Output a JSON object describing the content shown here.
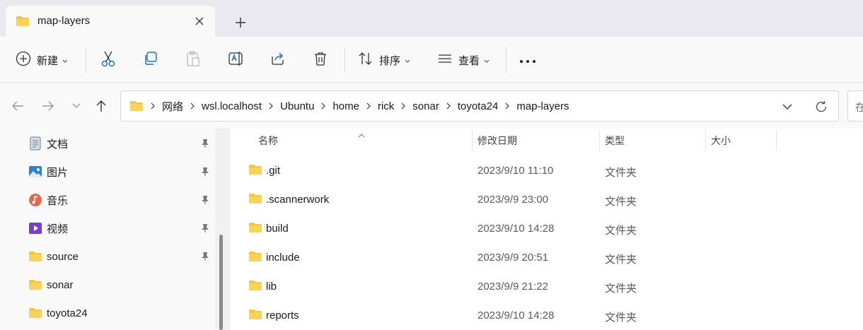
{
  "window": {
    "tab_title": "map-layers"
  },
  "toolbar": {
    "new_label": "新建",
    "sort_label": "排序",
    "view_label": "查看"
  },
  "address": {
    "crumbs": [
      "网络",
      "wsl.localhost",
      "Ubuntu",
      "home",
      "rick",
      "sonar",
      "toyota24",
      "map-layers"
    ],
    "search_placeholder": "在"
  },
  "sidebar": {
    "items": [
      {
        "label": "文档",
        "icon": "documents-icon",
        "pinned": true
      },
      {
        "label": "图片",
        "icon": "pictures-icon",
        "pinned": true
      },
      {
        "label": "音乐",
        "icon": "music-icon",
        "pinned": true
      },
      {
        "label": "视频",
        "icon": "videos-icon",
        "pinned": true
      },
      {
        "label": "source",
        "icon": "folder-icon",
        "pinned": true
      },
      {
        "label": "sonar",
        "icon": "folder-icon",
        "pinned": false
      },
      {
        "label": "toyota24",
        "icon": "folder-icon",
        "pinned": false
      }
    ]
  },
  "file_list": {
    "columns": {
      "name": "名称",
      "modified": "修改日期",
      "type": "类型",
      "size": "大小"
    },
    "rows": [
      {
        "name": ".git",
        "modified": "2023/9/10 11:10",
        "type": "文件夹"
      },
      {
        "name": ".scannerwork",
        "modified": "2023/9/9 23:00",
        "type": "文件夹"
      },
      {
        "name": "build",
        "modified": "2023/9/10 14:28",
        "type": "文件夹"
      },
      {
        "name": "include",
        "modified": "2023/9/9 20:51",
        "type": "文件夹"
      },
      {
        "name": "lib",
        "modified": "2023/9/9 21:22",
        "type": "文件夹"
      },
      {
        "name": "reports",
        "modified": "2023/9/10 14:28",
        "type": "文件夹"
      }
    ]
  },
  "colors": {
    "folder": "#f4c542",
    "folder_dark": "#e0a91f",
    "accent": "#0067c0"
  }
}
